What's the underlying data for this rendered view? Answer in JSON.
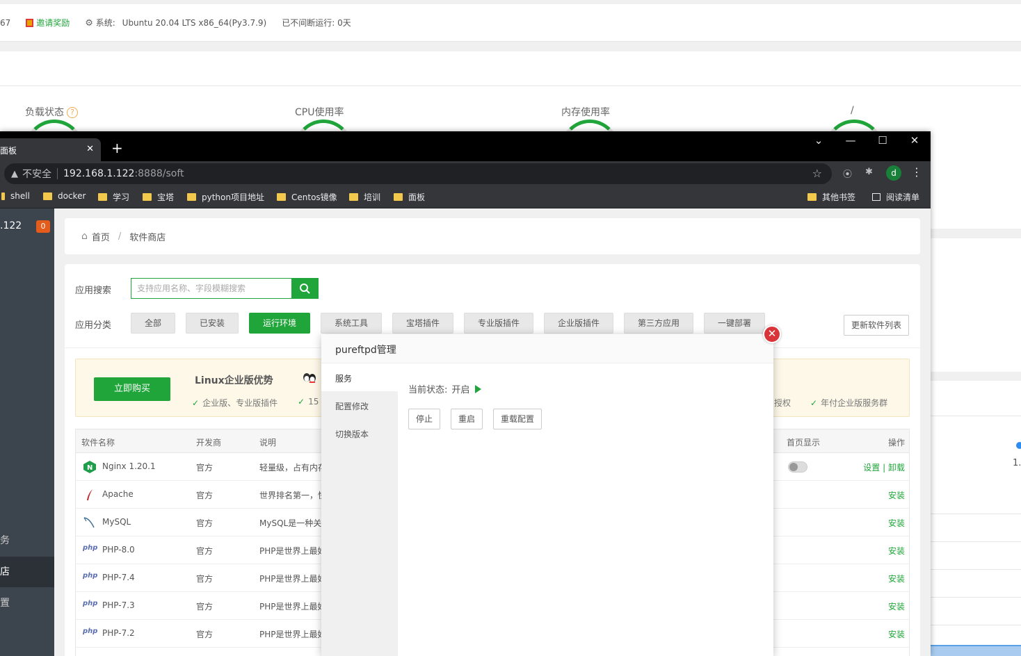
{
  "dashboard": {
    "topbar": {
      "partial_left": "67",
      "invite": "邀请奖励",
      "system_label": "系统:",
      "system_value": "Ubuntu 20.04 LTS x86_64(Py3.7.9)",
      "uptime": "已不间断运行: 0天"
    },
    "stats": {
      "load": "负载状态",
      "cpu": "CPU使用率",
      "mem": "内存使用率",
      "disk": "/"
    },
    "right_partial": "1."
  },
  "browser": {
    "tab_title": "面板",
    "address": {
      "security_label": "不安全",
      "host": "192.168.1.122",
      "path": ":8888/soft"
    },
    "profile_initial": "d",
    "bookmarks": [
      "shell",
      "docker",
      "学习",
      "宝塔",
      "python项目地址",
      "Centos镜像",
      "培训",
      "面板"
    ],
    "other_bookmarks": "其他书签",
    "reading_list": "阅读清单"
  },
  "panel": {
    "sidebar": {
      "ip_partial": ".122",
      "badge": "0",
      "items": [
        "务",
        "店",
        "置"
      ]
    },
    "breadcrumb": {
      "home": "首页",
      "sep": "/",
      "current": "软件商店"
    },
    "search": {
      "label": "应用搜索",
      "placeholder": "支持应用名称、字段模糊搜索"
    },
    "category_label": "应用分类",
    "categories": [
      "全部",
      "已安装",
      "运行环境",
      "系统工具",
      "宝塔插件",
      "专业版插件",
      "企业版插件",
      "第三方应用",
      "一键部署"
    ],
    "refresh_label": "更新软件列表",
    "promo": {
      "buy": "立即购买",
      "title": "Linux企业版优势",
      "features": [
        "企业版、专业版插件",
        "15",
        "授权",
        "年付企业版服务群"
      ]
    },
    "table": {
      "headers": [
        "软件名称",
        "开发商",
        "说明",
        "首页显示",
        "操作"
      ],
      "rows": [
        {
          "name": "Nginx 1.20.1",
          "dev": "官方",
          "desc": "轻量级，占有内存",
          "action_set": "设置",
          "action_sep": "|",
          "action_un": "卸载"
        },
        {
          "name": "Apache",
          "dev": "官方",
          "desc": "世界排名第一，快",
          "action": "安装"
        },
        {
          "name": "MySQL",
          "dev": "官方",
          "desc": "MySQL是一种关系",
          "action": "安装"
        },
        {
          "name": "PHP-8.0",
          "dev": "官方",
          "desc": "PHP是世界上最好",
          "action": "安装"
        },
        {
          "name": "PHP-7.4",
          "dev": "官方",
          "desc": "PHP是世界上最好",
          "action": "安装"
        },
        {
          "name": "PHP-7.3",
          "dev": "官方",
          "desc": "PHP是世界上最好",
          "action": "安装"
        },
        {
          "name": "PHP-7.2",
          "dev": "官方",
          "desc": "PHP是世界上最好",
          "action": "安装"
        }
      ]
    }
  },
  "modal": {
    "title": "pureftpd管理",
    "tabs": [
      "服务",
      "配置修改",
      "切换版本"
    ],
    "status_label": "当前状态:",
    "status_value": "开启",
    "buttons": [
      "停止",
      "重启",
      "重载配置"
    ]
  },
  "colors": {
    "accent": "#20a53a",
    "danger": "#d9343a",
    "badge": "#e45c1b"
  }
}
